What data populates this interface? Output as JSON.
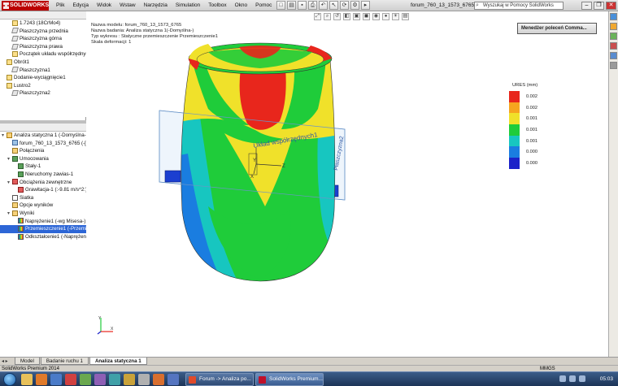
{
  "app": {
    "name": "SOLIDWORKS",
    "menu": [
      "Plik",
      "Edycja",
      "Widok",
      "Wstaw",
      "Narzędzia",
      "Simulation",
      "Toolbox",
      "Okno",
      "Pomoc"
    ],
    "document_title": "forum_760_13_1573_6765 *",
    "help_search_placeholder": "Wyszukaj w Pomocy SolidWorks"
  },
  "feature_tree": {
    "items": [
      {
        "label": "1.7243 (18CrMo4)",
        "icon": "material-icon",
        "indent": 1
      },
      {
        "label": "Płaszczyzna przednia",
        "icon": "plane-icon",
        "indent": 1
      },
      {
        "label": "Płaszczyzna górna",
        "icon": "plane-icon",
        "indent": 1
      },
      {
        "label": "Płaszczyzna prawa",
        "icon": "plane-icon",
        "indent": 1
      },
      {
        "label": "Początek układu współrzędnych",
        "icon": "origin-icon",
        "indent": 1
      },
      {
        "label": "Obrót1",
        "icon": "revolve-icon",
        "indent": 0
      },
      {
        "label": "Płaszczyzna1",
        "icon": "plane-icon",
        "indent": 1
      },
      {
        "label": "Dodanie-wyciągnięcie1",
        "icon": "extrude-icon",
        "indent": 0
      },
      {
        "label": "Lustro2",
        "icon": "mirror-icon",
        "indent": 0
      },
      {
        "label": "Płaszczyzna2",
        "icon": "plane-icon",
        "indent": 1
      }
    ]
  },
  "study_tree": {
    "items": [
      {
        "label": "Analiza statyczna 1 (-Domyślna-)",
        "icon": "study-icon",
        "indent": 0,
        "exp": "▾"
      },
      {
        "label": "forum_760_13_1573_6765 (-[SW]",
        "icon": "part-icon",
        "indent": 1,
        "exp": ""
      },
      {
        "label": "Połączenia",
        "icon": "connections-icon",
        "indent": 1,
        "exp": ""
      },
      {
        "label": "Umocowania",
        "icon": "fixture-icon",
        "indent": 1,
        "exp": "▾"
      },
      {
        "label": "Stały-1",
        "icon": "fixed-icon",
        "indent": 2,
        "exp": ""
      },
      {
        "label": "Nieruchomy zawias-1",
        "icon": "hinge-icon",
        "indent": 2,
        "exp": ""
      },
      {
        "label": "Obciążenia zewnętrzne",
        "icon": "load-icon",
        "indent": 1,
        "exp": "▾"
      },
      {
        "label": "Grawitacja-1 (:-9.81 m/s^2:)",
        "icon": "gravity-icon",
        "indent": 2,
        "exp": ""
      },
      {
        "label": "Siatka",
        "icon": "mesh-icon",
        "indent": 1,
        "exp": ""
      },
      {
        "label": "Opcje wyników",
        "icon": "result-options-icon",
        "indent": 1,
        "exp": ""
      },
      {
        "label": "Wyniki",
        "icon": "results-folder-icon",
        "indent": 1,
        "exp": "▾"
      },
      {
        "label": "Naprężenie1 (-wg Misesa-)",
        "icon": "result-plot-icon",
        "indent": 2,
        "exp": ""
      },
      {
        "label": "Przemieszczenie1 (-Przemieszczenie-)",
        "icon": "result-plot-icon",
        "indent": 2,
        "exp": "",
        "selected": true
      },
      {
        "label": "Odkształcenie1 (-Naprężenie-)",
        "icon": "result-plot-icon",
        "indent": 2,
        "exp": ""
      }
    ]
  },
  "viewport": {
    "model_info": [
      "Nazwa modelu: forum_760_13_1573_6765",
      "Nazwa badania: Analiza statyczna 1(-Domyślna-)",
      "Typ wykresu : Statyczne przemieszczenie Przemieszczenie1",
      "Skala deformacji: 1"
    ],
    "command_manager_label": "Menedżer poleceń Comma...",
    "coord_label": "Układ współrzędnych1",
    "plane_label": "Płaszczyzna2",
    "legend": {
      "title": "URES (mm)",
      "entries": [
        {
          "value": "0.002",
          "color": "#e8261c"
        },
        {
          "value": "0.002",
          "color": "#f6a51f"
        },
        {
          "value": "0.001",
          "color": "#f0e12a"
        },
        {
          "value": "0.001",
          "color": "#1fcc3a"
        },
        {
          "value": "0.001",
          "color": "#17c6c0"
        },
        {
          "value": "0.000",
          "color": "#1a7de0"
        },
        {
          "value": "0.000",
          "color": "#1b22c9"
        }
      ]
    }
  },
  "bottom_tabs": [
    "Model",
    "Badanie ruchu 1",
    "Analiza statyczna 1"
  ],
  "active_tab": "Analiza statyczna 1",
  "status": {
    "product": "SolidWorks Premium 2014",
    "units": "MMGS"
  },
  "taskbar": {
    "tasks": [
      "Forum -> Analiza po...",
      "SolidWorks Premium..."
    ],
    "clock": "05:03"
  }
}
